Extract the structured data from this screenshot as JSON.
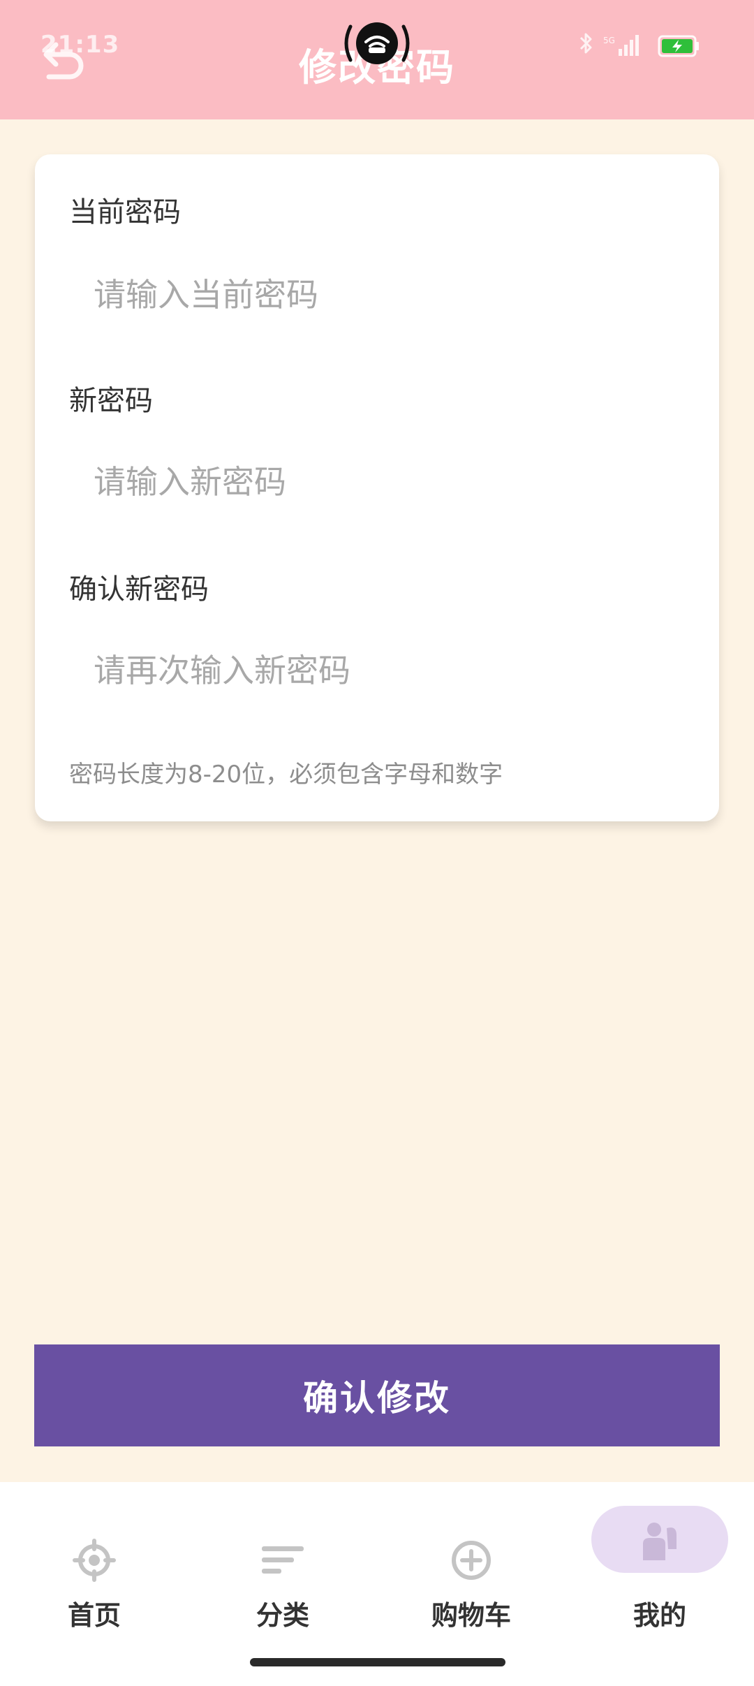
{
  "status_bar": {
    "time": "21:13",
    "network": "5G",
    "icons": [
      "bluetooth-icon",
      "signal-icon",
      "battery-charging-icon"
    ]
  },
  "header": {
    "title": "修改密码",
    "back_icon": "back-arrow-icon"
  },
  "form": {
    "current": {
      "label": "当前密码",
      "placeholder": "请输入当前密码",
      "value": ""
    },
    "new": {
      "label": "新密码",
      "placeholder": "请输入新密码",
      "value": ""
    },
    "confirm": {
      "label": "确认新密码",
      "placeholder": "请再次输入新密码",
      "value": ""
    },
    "hint": "密码长度为8-20位，必须包含字母和数字"
  },
  "submit_label": "确认修改",
  "nav": {
    "active": "mine",
    "items": [
      {
        "id": "home",
        "label": "首页",
        "icon": "compass-icon"
      },
      {
        "id": "category",
        "label": "分类",
        "icon": "list-lines-icon"
      },
      {
        "id": "cart",
        "label": "购物车",
        "icon": "plus-circle-icon"
      },
      {
        "id": "mine",
        "label": "我的",
        "icon": "person-icon"
      }
    ]
  },
  "colors": {
    "header": "#fbbcc3",
    "background": "#fdf3e4",
    "accent": "#6950a2",
    "active_pill": "#e8dcf3"
  }
}
